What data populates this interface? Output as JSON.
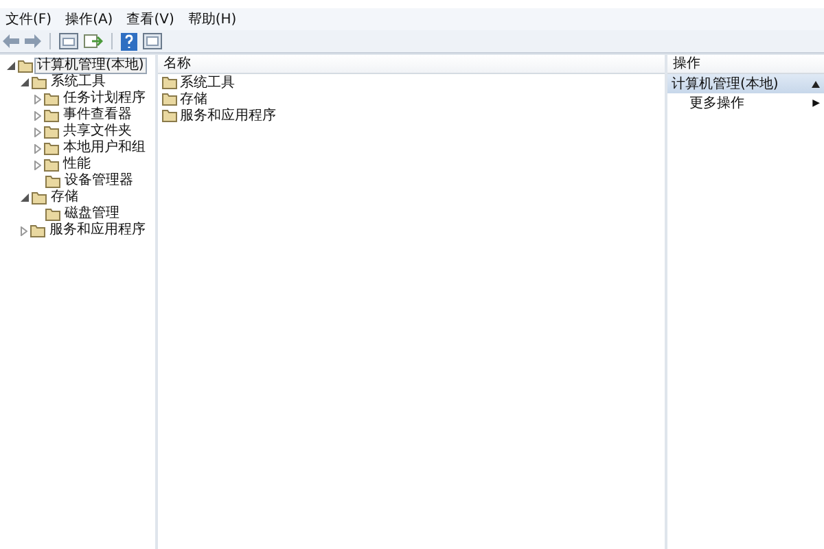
{
  "menu": [
    "文件(F)",
    "操作(A)",
    "查看(V)",
    "帮助(H)"
  ],
  "tree": [
    {
      "label": "计算机管理(本地)",
      "selected": true,
      "expanded": true,
      "children": [
        {
          "label": "系统工具",
          "selected": false,
          "expanded": true,
          "children": [
            {
              "label": "任务计划程序",
              "selected": false,
              "expanded": false
            },
            {
              "label": "事件查看器",
              "selected": false,
              "expanded": false
            },
            {
              "label": "共享文件夹",
              "selected": false,
              "expanded": false
            },
            {
              "label": "本地用户和组",
              "selected": false,
              "expanded": false
            },
            {
              "label": "性能",
              "selected": false,
              "expanded": false
            },
            {
              "label": "设备管理器",
              "selected": false
            }
          ]
        },
        {
          "label": "存储",
          "selected": false,
          "expanded": true,
          "children": [
            {
              "label": "磁盘管理",
              "selected": false
            }
          ]
        },
        {
          "label": "服务和应用程序",
          "selected": false,
          "expanded": false
        }
      ]
    }
  ],
  "list": {
    "column": "名称",
    "items": [
      "系统工具",
      "存储",
      "服务和应用程序"
    ]
  },
  "actions": {
    "header": "操作",
    "section": {
      "label": "计算机管理(本地)",
      "expanded": true
    },
    "items": [
      {
        "label": "更多操作",
        "arrow": "▶"
      }
    ]
  }
}
